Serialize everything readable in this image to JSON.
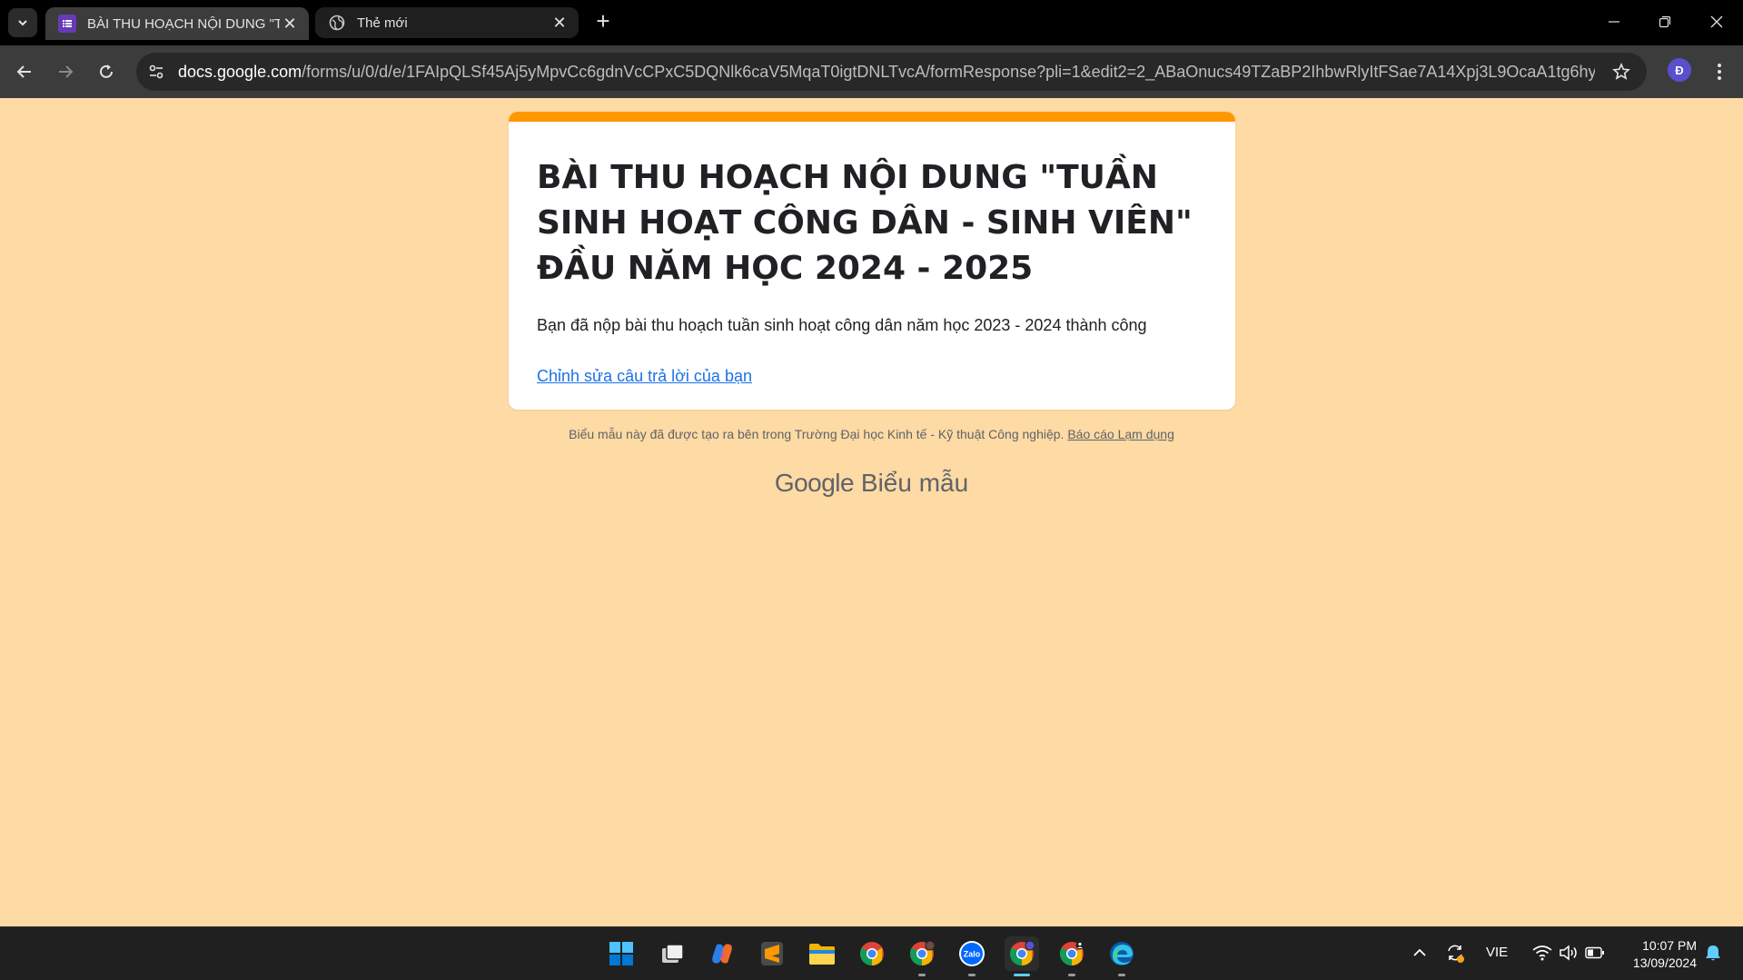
{
  "browser": {
    "tabs": [
      {
        "title": "BÀI THU HOẠCH NỘI DUNG \"TUẦN",
        "active": true,
        "icon": "forms-icon"
      },
      {
        "title": "Thẻ mới",
        "active": false,
        "icon": "globe-icon"
      }
    ],
    "url_host": "docs.google.com",
    "url_path": "/forms/u/0/d/e/1FAIpQLSf45Aj5yMpvCc6gdnVcCPxC5DQNlk6caV5MqaT0igtDNLTvcA/formResponse?pli=1&edit2=2_ABaOnucs49TZaBP2IhbwRlyItFSae7A14Xpj3L9OcaA1tg6hycy40ESh...",
    "profile_initial": "Đ"
  },
  "form": {
    "accent_color": "#ff9800",
    "background_color": "#fedaa4",
    "title": "BÀI THU HOẠCH NỘI DUNG \"TUẦN SINH HOẠT CÔNG DÂN - SINH VIÊN\" ĐẦU NĂM HỌC 2024 - 2025",
    "confirmation": "Bạn đã nộp bài thu hoạch tuần sinh hoạt công dân năm học 2023 - 2024 thành công",
    "edit_link": "Chỉnh sửa câu trả lời của bạn"
  },
  "footer": {
    "note": "Biểu mẫu này đã được tạo ra bên trong Trường Đại học Kinh tế - Kỹ thuật Công nghiệp.",
    "report_link": "Báo cáo Lạm dụng",
    "brand_google": "Google",
    "brand_forms": "Biểu mẫu"
  },
  "taskbar": {
    "apps": [
      "windows-start-icon",
      "task-view-icon",
      "copilot-icon",
      "sublime-text-icon",
      "file-explorer-icon",
      "chrome-icon",
      "chrome-profile-icon",
      "zalo-icon",
      "chrome-active-icon",
      "chrome-user-icon",
      "edge-icon"
    ],
    "zalo_label": "Zalo",
    "language": "VIE",
    "time": "10:07 PM",
    "date": "13/09/2024"
  }
}
